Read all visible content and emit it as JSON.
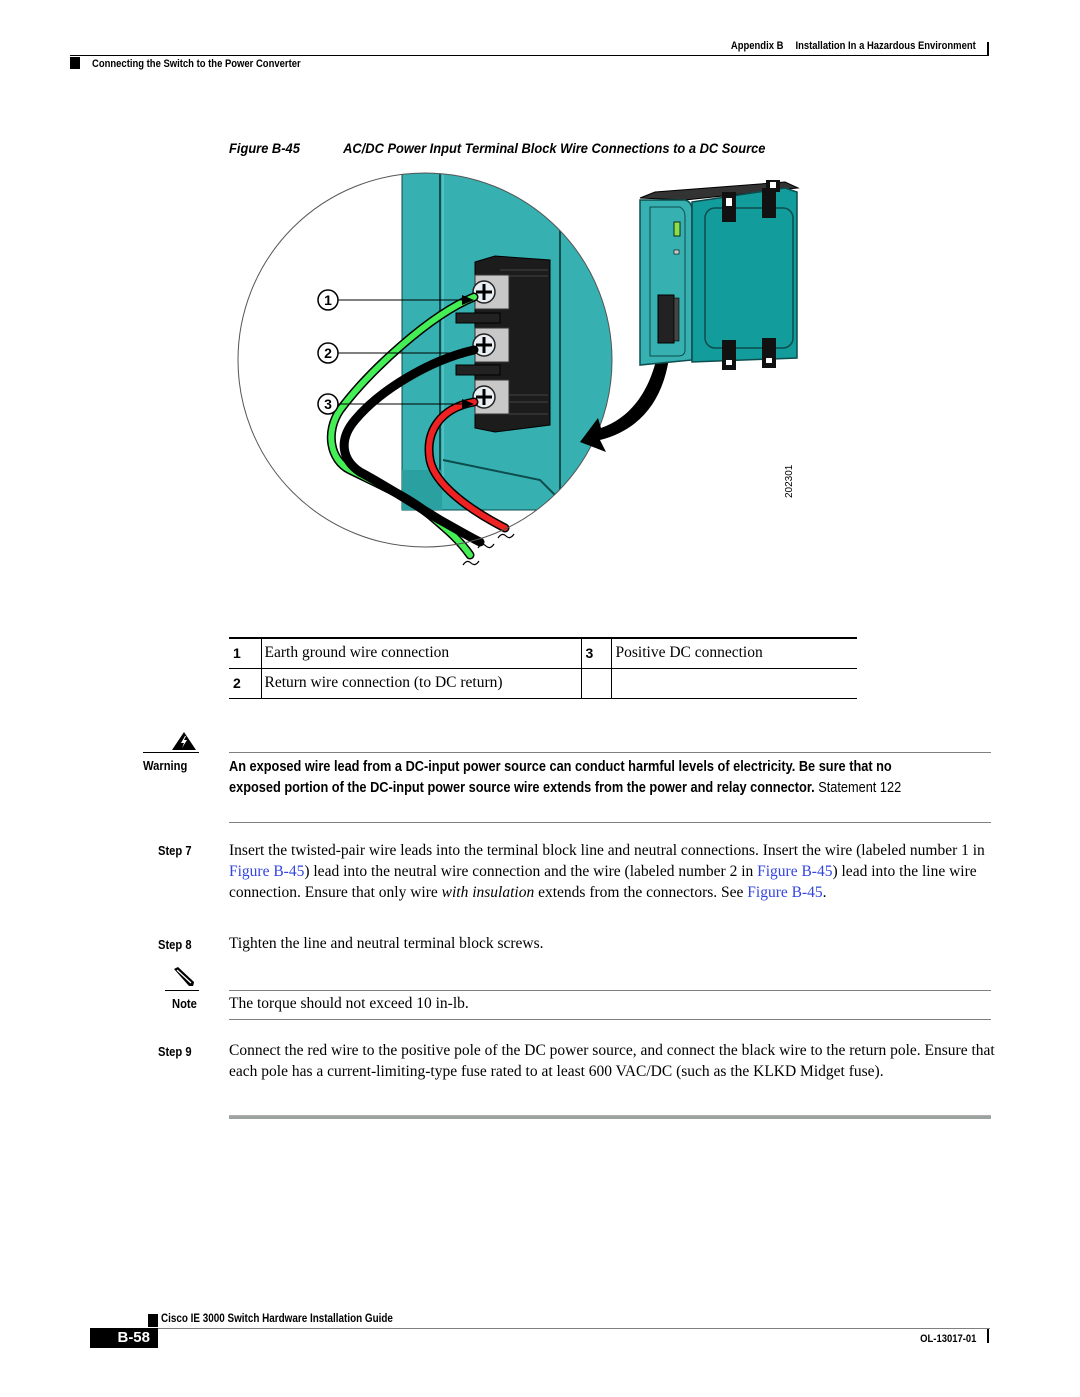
{
  "header": {
    "chapter": "Appendix B",
    "chapter_title": "Installation In a Hazardous Environment",
    "section": "Connecting the Switch to the Power Converter"
  },
  "figure": {
    "number": "Figure B-45",
    "title": "AC/DC Power Input Terminal Block Wire Connections to a DC Source",
    "image_id": "202301",
    "callouts": [
      "1",
      "2",
      "3"
    ],
    "colors": {
      "device_teal": "#36b0b0",
      "device_dark_teal": "#139c9c",
      "ground_wire": "#44ee55",
      "return_wire": "#000000",
      "positive_wire": "#ee2222",
      "terminal_block": "#1a1a1a"
    }
  },
  "legend": {
    "rows": [
      {
        "num": "1",
        "desc": "Earth ground wire connection",
        "num2": "3",
        "desc2": "Positive DC connection"
      },
      {
        "num": "2",
        "desc": "Return wire connection (to DC return)",
        "num2": "",
        "desc2": ""
      }
    ]
  },
  "warning": {
    "label": "Warning",
    "icon": "warning-triangle-icon",
    "text": "An exposed wire lead from a DC-input power source can conduct harmful levels of electricity. Be sure that no exposed portion of the DC-input power source wire extends from the power and relay connector.",
    "statement": "Statement 122"
  },
  "steps": [
    {
      "label": "Step 7",
      "parts": [
        {
          "t": "Insert the twisted-pair wire leads into the terminal block line and neutral connections. Insert the wire (labeled number 1 in "
        },
        {
          "link": "Figure B-45"
        },
        {
          "t": ") lead into the neutral wire connection and the wire (labeled number 2 in "
        },
        {
          "link": "Figure B-45"
        },
        {
          "t": ") lead into the line wire connection. Ensure that only wire "
        },
        {
          "i": "with insulation"
        },
        {
          "t": " extends from the connectors. See "
        },
        {
          "link": "Figure B-45"
        },
        {
          "t": "."
        }
      ]
    },
    {
      "label": "Step 8",
      "parts": [
        {
          "t": "Tighten the line and neutral terminal block screws."
        }
      ]
    },
    {
      "label": "Step 9",
      "parts": [
        {
          "t": "Connect the red wire to the positive pole of the DC power source, and connect the black wire to the return pole. Ensure that each pole has a current-limiting-type fuse rated to at least 600 VAC/DC (such as the KLKD Midget fuse)."
        }
      ]
    }
  ],
  "note": {
    "label": "Note",
    "icon": "pencil-note-icon",
    "text": "The torque should not exceed 10 in-lb."
  },
  "footer": {
    "guide_title": "Cisco IE 3000 Switch Hardware Installation Guide",
    "page": "B-58",
    "doc_number": "OL-13017-01"
  }
}
